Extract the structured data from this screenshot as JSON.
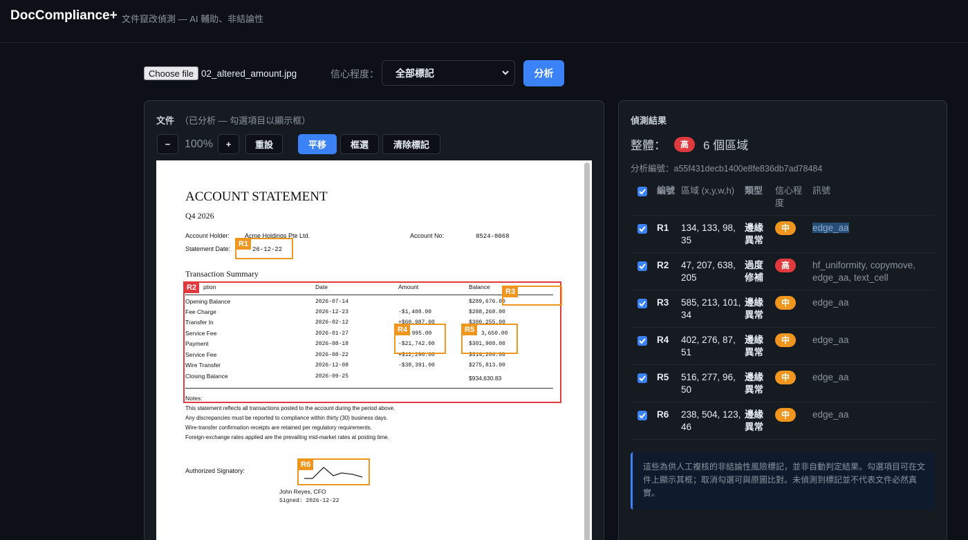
{
  "header": {
    "brand": "DocCompliance+",
    "tagline": "文件竄改偵測 — AI 輔助、非結論性"
  },
  "controls": {
    "choose_file_label": "Choose file",
    "file_name": "02_altered_amount.jpg",
    "confidence_label": "信心程度：",
    "confidence_value": "全部標記",
    "analyze_label": "分析"
  },
  "document_panel": {
    "title": "文件",
    "subtitle": "（已分析 — 勾選項目以顯示框）",
    "toolbar": {
      "zoom_out": "−",
      "zoom_level": "100%",
      "zoom_in": "+",
      "reset": "重設",
      "pan": "平移",
      "select": "框選",
      "clear": "清除標記"
    }
  },
  "statement": {
    "title": "ACCOUNT STATEMENT",
    "period": "Q4 2026",
    "holder_label": "Account Holder:",
    "holder_value": "Acme Holdings Pte Ltd.",
    "account_no_label": "Account No:",
    "account_no_value": "8524-8068",
    "date_label": "Statement Date:",
    "date_value": "26-12-22",
    "summary_title": "Transaction Summary",
    "columns": [
      "ption",
      "Date",
      "Amount",
      "Balance"
    ],
    "rows": [
      {
        "desc": "Opening Balance",
        "date": "2026-07-14",
        "amount": "",
        "balance": "$289,676.00"
      },
      {
        "desc": "Fee Charge",
        "date": "2026-12-23",
        "amount": "-$1,408.00",
        "balance": "$288,268.00"
      },
      {
        "desc": "Transfer In",
        "date": "2026-02-12",
        "amount": "+$60,987.00",
        "balance": "$300,255.00"
      },
      {
        "desc": "Service Fee",
        "date": "2026-01-27",
        "amount": "$,995.00",
        "balance": "3,650.00"
      },
      {
        "desc": "Payment",
        "date": "2026-08-18",
        "amount": "-$21,742.00",
        "balance": "$301,908.00"
      },
      {
        "desc": "Service Fee",
        "date": "2026-08-22",
        "amount": "+$12,296.00",
        "balance": "$314,204.00"
      },
      {
        "desc": "Wire Transfer",
        "date": "2026-12-08",
        "amount": "-$38,391.00",
        "balance": "$275,813.00"
      },
      {
        "desc": "Closing Balance",
        "date": "2026-09-25",
        "amount": "",
        "balance": "$934,630.83"
      }
    ],
    "notes_title": "Notes:",
    "notes": [
      "This statement reflects all transactions posted to the account during the period above.",
      "Any discrepancies must be reported to compliance within thirty (30) business days.",
      "Wire-transfer confirmation receipts are retained per regulatory requirements.",
      "Foreign-exchange rates applied are the prevailing mid-market rates at posting time."
    ],
    "signatory_label": "Authorized Signatory:",
    "signer_name": "John Reyes, CFO",
    "signed_line": "Signed: 2026-12-22"
  },
  "regions_overlay": [
    "R1",
    "R2",
    "R3",
    "R4",
    "R5",
    "R6"
  ],
  "results": {
    "title": "偵測結果",
    "overall_label": "整體：",
    "overall_level": "高",
    "overall_count": "6 個區域",
    "analysis_id": "分析編號：a55f431decb1400e8fe836db7ad78484",
    "columns": {
      "id": "編號",
      "region": "區域 (x,y,w,h)",
      "type": "類型",
      "confidence": "信心程度",
      "signal": "訊號"
    },
    "rows": [
      {
        "id": "R1",
        "region": "134, 133, 98, 35",
        "type": "邊緣異常",
        "level": "中",
        "level_key": "mid",
        "signal": "edge_aa"
      },
      {
        "id": "R2",
        "region": "47, 207, 638, 205",
        "type": "過度修補",
        "level": "高",
        "level_key": "high",
        "signal": "hf_uniformity, copymove, edge_aa, text_cell"
      },
      {
        "id": "R3",
        "region": "585, 213, 101, 34",
        "type": "邊緣異常",
        "level": "中",
        "level_key": "mid",
        "signal": "edge_aa"
      },
      {
        "id": "R4",
        "region": "402, 276, 87, 51",
        "type": "邊緣異常",
        "level": "中",
        "level_key": "mid",
        "signal": "edge_aa"
      },
      {
        "id": "R5",
        "region": "516, 277, 96, 50",
        "type": "邊緣異常",
        "level": "中",
        "level_key": "mid",
        "signal": "edge_aa"
      },
      {
        "id": "R6",
        "region": "238, 504, 123, 46",
        "type": "邊緣異常",
        "level": "中",
        "level_key": "mid",
        "signal": "edge_aa"
      }
    ],
    "note": "這些為供人工複核的非結論性風險標記，並非自動判定結果。勾選項目可在文件上顯示其框；取消勾選可與原圖比對。未偵測到標記並不代表文件必然真實。"
  },
  "colors": {
    "accent": "#3b82f6",
    "high": "#e0393e",
    "mid": "#f0961f",
    "background": "#0d1117",
    "panel": "#161b22"
  }
}
